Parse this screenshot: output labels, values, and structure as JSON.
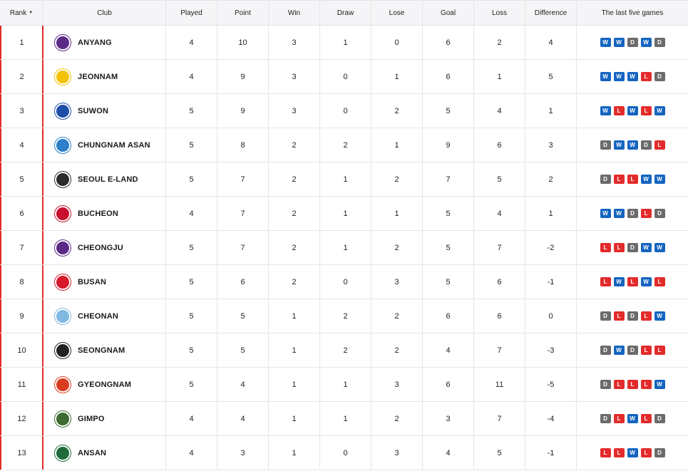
{
  "headers": {
    "rank": "Rank",
    "club": "Club",
    "played": "Played",
    "point": "Point",
    "win": "Win",
    "draw": "Draw",
    "lose": "Lose",
    "goal": "Goal",
    "loss": "Loss",
    "difference": "Difference",
    "last_five": "The last five games"
  },
  "colors": {
    "win": "#1565c0",
    "draw": "#6b6b6b",
    "loss": "#e32b2b",
    "accent": "#e32b2b"
  },
  "rows": [
    {
      "rank": "1",
      "club": "ANYANG",
      "played": "4",
      "point": "10",
      "win": "3",
      "draw": "1",
      "lose": "0",
      "goal": "6",
      "loss": "2",
      "diff": "4",
      "last": [
        "W",
        "W",
        "D",
        "W",
        "D"
      ],
      "logo_color": "#5b2a86",
      "logo_icon": "anyang-crest-icon"
    },
    {
      "rank": "2",
      "club": "JEONNAM",
      "played": "4",
      "point": "9",
      "win": "3",
      "draw": "0",
      "lose": "1",
      "goal": "6",
      "loss": "1",
      "diff": "5",
      "last": [
        "W",
        "W",
        "W",
        "L",
        "D"
      ],
      "logo_color": "#f2c200",
      "logo_icon": "jeonnam-crest-icon"
    },
    {
      "rank": "3",
      "club": "SUWON",
      "played": "5",
      "point": "9",
      "win": "3",
      "draw": "0",
      "lose": "2",
      "goal": "5",
      "loss": "4",
      "diff": "1",
      "last": [
        "W",
        "L",
        "W",
        "L",
        "W"
      ],
      "logo_color": "#1d4fa8",
      "logo_icon": "suwon-crest-icon"
    },
    {
      "rank": "4",
      "club": "CHUNGNAM ASAN",
      "played": "5",
      "point": "8",
      "win": "2",
      "draw": "2",
      "lose": "1",
      "goal": "9",
      "loss": "6",
      "diff": "3",
      "last": [
        "D",
        "W",
        "W",
        "D",
        "L"
      ],
      "logo_color": "#2c7fc9",
      "logo_icon": "chungnam-asan-crest-icon"
    },
    {
      "rank": "5",
      "club": "SEOUL E-LAND",
      "played": "5",
      "point": "7",
      "win": "2",
      "draw": "1",
      "lose": "2",
      "goal": "7",
      "loss": "5",
      "diff": "2",
      "last": [
        "D",
        "L",
        "L",
        "W",
        "W"
      ],
      "logo_color": "#2b2b2b",
      "logo_icon": "seoul-eland-crest-icon"
    },
    {
      "rank": "6",
      "club": "BUCHEON",
      "played": "4",
      "point": "7",
      "win": "2",
      "draw": "1",
      "lose": "1",
      "goal": "5",
      "loss": "4",
      "diff": "1",
      "last": [
        "W",
        "W",
        "D",
        "L",
        "D"
      ],
      "logo_color": "#c8102e",
      "logo_icon": "bucheon-crest-icon"
    },
    {
      "rank": "7",
      "club": "CHEONGJU",
      "played": "5",
      "point": "7",
      "win": "2",
      "draw": "1",
      "lose": "2",
      "goal": "5",
      "loss": "7",
      "diff": "-2",
      "last": [
        "L",
        "L",
        "D",
        "W",
        "W"
      ],
      "logo_color": "#5b2a86",
      "logo_icon": "cheongju-crest-icon"
    },
    {
      "rank": "8",
      "club": "BUSAN",
      "played": "5",
      "point": "6",
      "win": "2",
      "draw": "0",
      "lose": "3",
      "goal": "5",
      "loss": "6",
      "diff": "-1",
      "last": [
        "L",
        "W",
        "L",
        "W",
        "L"
      ],
      "logo_color": "#d7192a",
      "logo_icon": "busan-crest-icon"
    },
    {
      "rank": "9",
      "club": "CHEONAN",
      "played": "5",
      "point": "5",
      "win": "1",
      "draw": "2",
      "lose": "2",
      "goal": "6",
      "loss": "6",
      "diff": "0",
      "last": [
        "D",
        "L",
        "D",
        "L",
        "W"
      ],
      "logo_color": "#7fb8e0",
      "logo_icon": "cheonan-crest-icon"
    },
    {
      "rank": "10",
      "club": "SEONGNAM",
      "played": "5",
      "point": "5",
      "win": "1",
      "draw": "2",
      "lose": "2",
      "goal": "4",
      "loss": "7",
      "diff": "-3",
      "last": [
        "D",
        "W",
        "D",
        "L",
        "L"
      ],
      "logo_color": "#222222",
      "logo_icon": "seongnam-crest-icon"
    },
    {
      "rank": "11",
      "club": "GYEONGNAM",
      "played": "5",
      "point": "4",
      "win": "1",
      "draw": "1",
      "lose": "3",
      "goal": "6",
      "loss": "11",
      "diff": "-5",
      "last": [
        "D",
        "L",
        "L",
        "L",
        "W"
      ],
      "logo_color": "#d93b1f",
      "logo_icon": "gyeongnam-crest-icon"
    },
    {
      "rank": "12",
      "club": "GIMPO",
      "played": "4",
      "point": "4",
      "win": "1",
      "draw": "1",
      "lose": "2",
      "goal": "3",
      "loss": "7",
      "diff": "-4",
      "last": [
        "D",
        "L",
        "W",
        "L",
        "D"
      ],
      "logo_color": "#3d6b2f",
      "logo_icon": "gimpo-crest-icon"
    },
    {
      "rank": "13",
      "club": "ANSAN",
      "played": "4",
      "point": "3",
      "win": "1",
      "draw": "0",
      "lose": "3",
      "goal": "4",
      "loss": "5",
      "diff": "-1",
      "last": [
        "L",
        "L",
        "W",
        "L",
        "D"
      ],
      "logo_color": "#1f6b3a",
      "logo_icon": "ansan-crest-icon"
    }
  ]
}
